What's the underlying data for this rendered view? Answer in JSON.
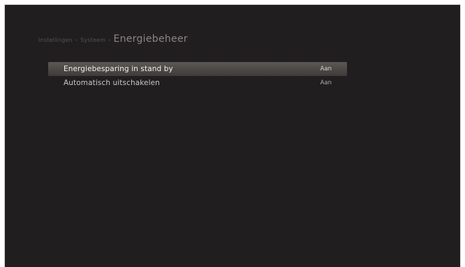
{
  "breadcrumb": {
    "items": [
      "Instellingen",
      "Systeem"
    ],
    "current": "Energiebeheer"
  },
  "menu": {
    "items": [
      {
        "label": "Energiebesparing in stand by",
        "value": "Aan",
        "selected": true
      },
      {
        "label": "Automatisch uitschakelen",
        "value": "Aan",
        "selected": false
      }
    ]
  }
}
